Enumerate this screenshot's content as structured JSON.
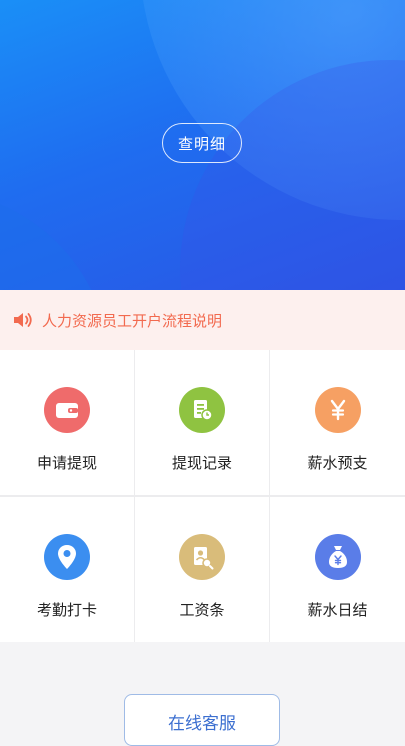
{
  "hero": {
    "detail_button_label": "查明细"
  },
  "notice": {
    "icon": "speaker-icon",
    "text": "人力资源员工开户流程说明"
  },
  "grid": {
    "items": [
      {
        "label": "申请提现",
        "icon": "wallet-icon",
        "color": "#ef6b6b"
      },
      {
        "label": "提现记录",
        "icon": "record-icon",
        "color": "#8fc341"
      },
      {
        "label": "薪水预支",
        "icon": "yen-icon",
        "color": "#f6a063"
      },
      {
        "label": "考勤打卡",
        "icon": "location-pin-icon",
        "color": "#3b8ef0"
      },
      {
        "label": "工资条",
        "icon": "payslip-icon",
        "color": "#d9bc7a"
      },
      {
        "label": "薪水日结",
        "icon": "money-bag-icon",
        "color": "#5a7de8"
      }
    ]
  },
  "footer": {
    "online_button_label": "在线客服"
  },
  "colors": {
    "accent_blue": "#1f6df0",
    "notice_text": "#f26a4f",
    "notice_bg": "#fdf0ee"
  }
}
